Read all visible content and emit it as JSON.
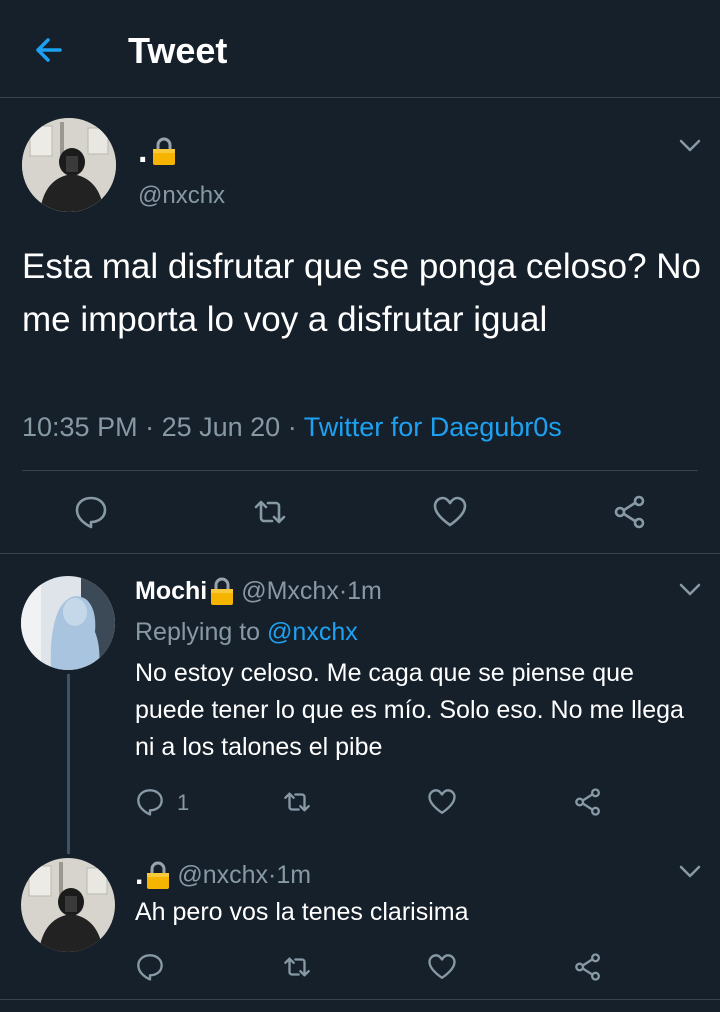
{
  "header": {
    "title": "Tweet",
    "back_icon": "arrow-left-icon",
    "accent": "#1da1f2"
  },
  "main_tweet": {
    "display_name": ".",
    "handle": "@nxchx",
    "text": "Esta mal disfrutar que se ponga celoso? No me importa lo voy a disfrutar igual",
    "time": "10:35 PM",
    "sep1": " · ",
    "date": "25 Jun 20",
    "sep2": " · ",
    "source": "Twitter for Daegubr0s",
    "actions": [
      "reply-icon",
      "retweet-icon",
      "like-icon",
      "share-icon"
    ]
  },
  "replies": [
    {
      "display_name": "Mochi",
      "handle": "@Mxchx",
      "sep": " · ",
      "time": "1m",
      "replying_prefix": "Replying to ",
      "replying_to": "@nxchx",
      "text": "No estoy celoso. Me caga que se piense que puede tener lo que es mío. Solo eso. No me llega ni a los talones el pibe",
      "reply_count": "1"
    },
    {
      "display_name": ".",
      "handle": "@nxchx",
      "sep": " · ",
      "time": "1m",
      "text": "Ah pero vos la tenes clarisima"
    }
  ],
  "colors": {
    "background": "#15202b",
    "divider": "#38444d",
    "secondary_text": "#8899a6",
    "lock_gold": "#f4b400"
  }
}
